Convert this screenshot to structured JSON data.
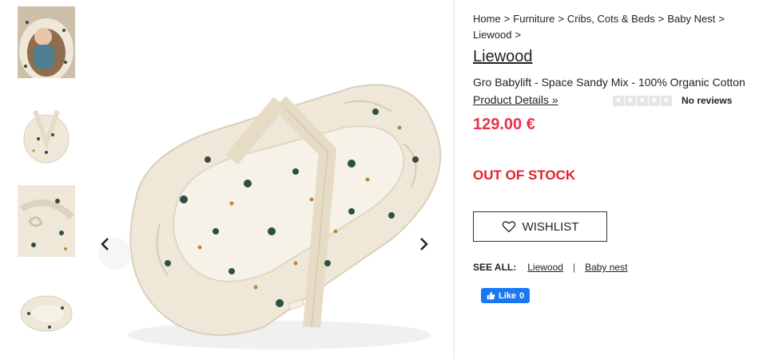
{
  "breadcrumb": {
    "items": [
      "Home",
      "Furniture",
      "Cribs, Cots & Beds",
      "Baby Nest",
      "Liewood"
    ],
    "separator": ">"
  },
  "product": {
    "brand": "Liewood",
    "name": "Gro Babylift - Space Sandy Mix - 100% Organic Cotton",
    "details_link": "Product Details »",
    "reviews_text": "No reviews",
    "rating": 0,
    "price": "129.00 €",
    "stock_status": "OUT OF STOCK"
  },
  "wishlist": {
    "label": "WISHLIST",
    "icon": "heart-outline-icon"
  },
  "see_all": {
    "label": "SEE ALL:",
    "links": [
      "Liewood",
      "Baby nest"
    ],
    "separator": "|"
  },
  "social": {
    "like_label": "Like",
    "like_count": "0",
    "icon": "thumbs-up-icon"
  },
  "gallery": {
    "thumbnail_count": 4,
    "icons": {
      "prev": "chevron-left-icon",
      "next": "chevron-right-icon"
    }
  },
  "colors": {
    "price": "#e8334a",
    "stock": "#e3222b",
    "facebook": "#1877f2",
    "fabric": "#f1ecdf"
  }
}
